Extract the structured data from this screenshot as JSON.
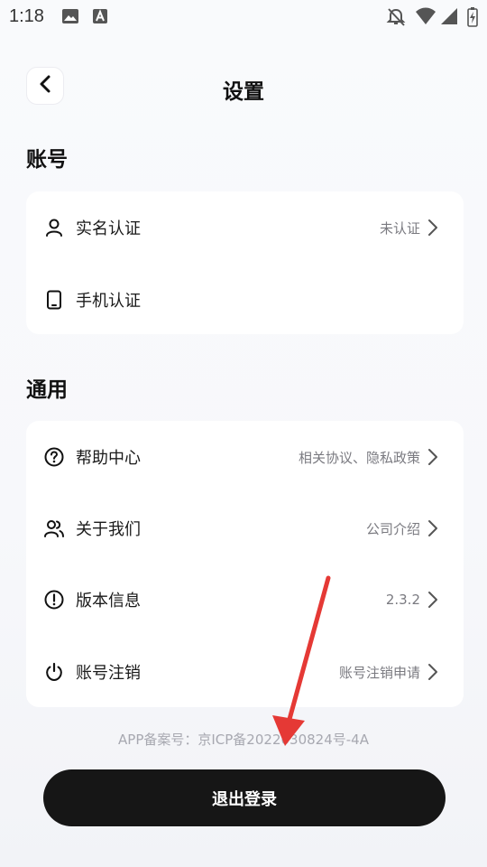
{
  "status_bar": {
    "time": "1:18",
    "left_icons": [
      "image-icon",
      "text-a-icon"
    ],
    "right_icons": [
      "bell-off-icon",
      "wifi-icon",
      "signal-icon",
      "battery-icon"
    ]
  },
  "header": {
    "title": "设置",
    "back_icon": "chevron-left-icon"
  },
  "account_section": {
    "title": "账号",
    "items": [
      {
        "label": "实名认证",
        "value": "未认证",
        "icon": "person-icon",
        "has_chevron": true
      },
      {
        "label": "手机认证",
        "value": "",
        "icon": "phone-icon",
        "has_chevron": false
      }
    ]
  },
  "general_section": {
    "title": "通用",
    "items": [
      {
        "label": "帮助中心",
        "value": "相关协议、隐私政策",
        "icon": "help-circle-icon",
        "has_chevron": true
      },
      {
        "label": "关于我们",
        "value": "公司介绍",
        "icon": "users-icon",
        "has_chevron": true
      },
      {
        "label": "版本信息",
        "value": "2.3.2",
        "icon": "alert-circle-icon",
        "has_chevron": true
      },
      {
        "label": "账号注销",
        "value": "账号注销申请",
        "icon": "power-icon",
        "has_chevron": true
      }
    ]
  },
  "footer": {
    "icp": "APP备案号：京ICP备2022030824号-4A",
    "logout_label": "退出登录"
  },
  "colors": {
    "logout_bg": "#161616",
    "annotation_arrow": "#e53935",
    "secondary_text": "#7a7a80"
  }
}
